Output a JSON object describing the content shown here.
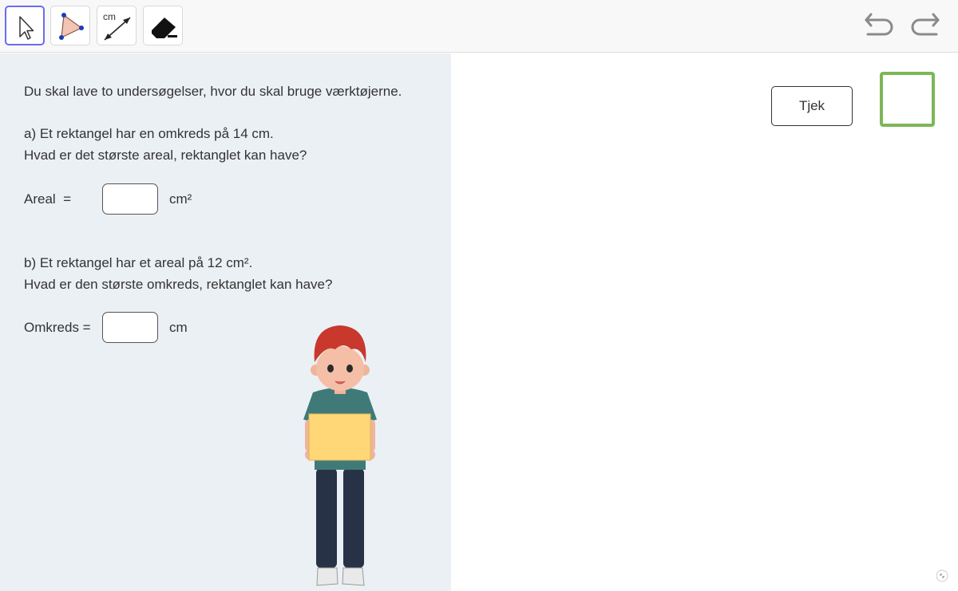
{
  "toolbar": {
    "tools": [
      {
        "name": "move",
        "icon": "cursor-arrow-icon",
        "active": true
      },
      {
        "name": "polygon",
        "icon": "triangle-polygon-icon",
        "active": false
      },
      {
        "name": "distance",
        "icon": "distance-measure-icon",
        "label": "cm",
        "active": false
      },
      {
        "name": "eraser",
        "icon": "eraser-icon",
        "active": false
      }
    ],
    "undo_icon": "undo-icon",
    "redo_icon": "redo-icon"
  },
  "task": {
    "intro": "Du skal lave to undersøgelser, hvor du skal bruge værktøjerne.",
    "a_line1": "a) Et rektangel har en omkreds på 14 cm.",
    "a_line2": "Hvad er det største areal, rektanglet kan have?",
    "a_label": "Areal  =",
    "a_unit": "cm²",
    "a_value": "",
    "b_line1": "b) Et rektangel har et areal på 12 cm².",
    "b_line2": "Hvad er den største omkreds, rektanglet kan have?",
    "b_label": "Omkreds =",
    "b_unit": "cm",
    "b_value": ""
  },
  "check_button": "Tjek",
  "colors": {
    "active_tool_border": "#6b6bf0",
    "left_panel_bg": "#ebf0f5",
    "status_box_border": "#7cb757",
    "polygon_fill": "#f2c4b4",
    "polygon_vertex": "#1f3bb3"
  }
}
